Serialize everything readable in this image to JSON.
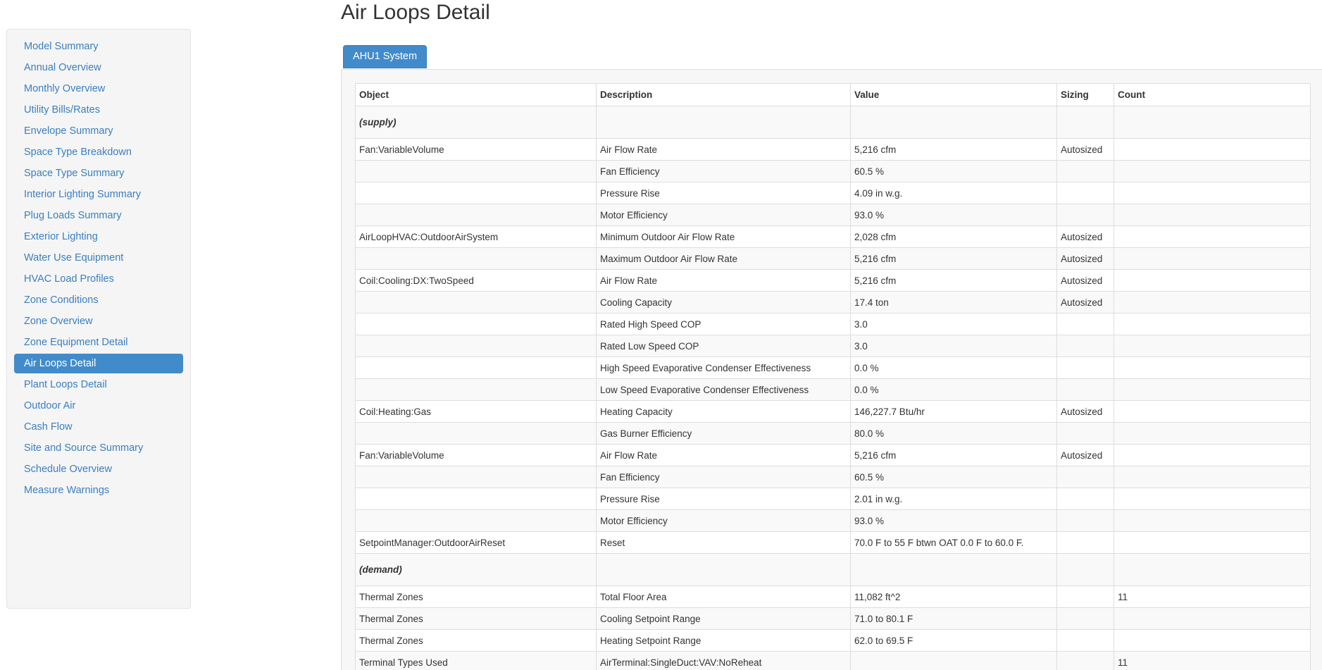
{
  "page": {
    "title": "Air Loops Detail"
  },
  "sidebar": {
    "items": [
      {
        "label": "Model Summary",
        "active": false
      },
      {
        "label": "Annual Overview",
        "active": false
      },
      {
        "label": "Monthly Overview",
        "active": false
      },
      {
        "label": "Utility Bills/Rates",
        "active": false
      },
      {
        "label": "Envelope Summary",
        "active": false
      },
      {
        "label": "Space Type Breakdown",
        "active": false
      },
      {
        "label": "Space Type Summary",
        "active": false
      },
      {
        "label": "Interior Lighting Summary",
        "active": false
      },
      {
        "label": "Plug Loads Summary",
        "active": false
      },
      {
        "label": "Exterior Lighting",
        "active": false
      },
      {
        "label": "Water Use Equipment",
        "active": false
      },
      {
        "label": "HVAC Load Profiles",
        "active": false
      },
      {
        "label": "Zone Conditions",
        "active": false
      },
      {
        "label": "Zone Overview",
        "active": false
      },
      {
        "label": "Zone Equipment Detail",
        "active": false
      },
      {
        "label": "Air Loops Detail",
        "active": true
      },
      {
        "label": "Plant Loops Detail",
        "active": false
      },
      {
        "label": "Outdoor Air",
        "active": false
      },
      {
        "label": "Cash Flow",
        "active": false
      },
      {
        "label": "Site and Source Summary",
        "active": false
      },
      {
        "label": "Schedule Overview",
        "active": false
      },
      {
        "label": "Measure Warnings",
        "active": false
      }
    ]
  },
  "tabs": [
    {
      "label": "AHU1 System",
      "active": true
    }
  ],
  "table": {
    "headers": [
      "Object",
      "Description",
      "Value",
      "Sizing",
      "Count"
    ],
    "rows": [
      {
        "section": true,
        "object": "(supply)",
        "description": "",
        "value": "",
        "sizing": "",
        "count": ""
      },
      {
        "object": "Fan:VariableVolume",
        "description": "Air Flow Rate",
        "value": "5,216 cfm",
        "sizing": "Autosized",
        "count": ""
      },
      {
        "object": "",
        "description": "Fan Efficiency",
        "value": "60.5 %",
        "sizing": "",
        "count": ""
      },
      {
        "object": "",
        "description": "Pressure Rise",
        "value": "4.09 in w.g.",
        "sizing": "",
        "count": ""
      },
      {
        "object": "",
        "description": "Motor Efficiency",
        "value": "93.0 %",
        "sizing": "",
        "count": ""
      },
      {
        "object": "AirLoopHVAC:OutdoorAirSystem",
        "description": "Minimum Outdoor Air Flow Rate",
        "value": "2,028 cfm",
        "sizing": "Autosized",
        "count": ""
      },
      {
        "object": "",
        "description": "Maximum Outdoor Air Flow Rate",
        "value": "5,216 cfm",
        "sizing": "Autosized",
        "count": ""
      },
      {
        "object": "Coil:Cooling:DX:TwoSpeed",
        "description": "Air Flow Rate",
        "value": "5,216 cfm",
        "sizing": "Autosized",
        "count": ""
      },
      {
        "object": "",
        "description": "Cooling Capacity",
        "value": "17.4 ton",
        "sizing": "Autosized",
        "count": ""
      },
      {
        "object": "",
        "description": "Rated High Speed COP",
        "value": "3.0",
        "sizing": "",
        "count": ""
      },
      {
        "object": "",
        "description": "Rated Low Speed COP",
        "value": "3.0",
        "sizing": "",
        "count": ""
      },
      {
        "object": "",
        "description": "High Speed Evaporative Condenser Effectiveness",
        "value": "0.0 %",
        "sizing": "",
        "count": ""
      },
      {
        "object": "",
        "description": "Low Speed Evaporative Condenser Effectiveness",
        "value": "0.0 %",
        "sizing": "",
        "count": ""
      },
      {
        "object": "Coil:Heating:Gas",
        "description": "Heating Capacity",
        "value": "146,227.7 Btu/hr",
        "sizing": "Autosized",
        "count": ""
      },
      {
        "object": "",
        "description": "Gas Burner Efficiency",
        "value": "80.0 %",
        "sizing": "",
        "count": ""
      },
      {
        "object": "Fan:VariableVolume",
        "description": "Air Flow Rate",
        "value": "5,216 cfm",
        "sizing": "Autosized",
        "count": ""
      },
      {
        "object": "",
        "description": "Fan Efficiency",
        "value": "60.5 %",
        "sizing": "",
        "count": ""
      },
      {
        "object": "",
        "description": "Pressure Rise",
        "value": "2.01 in w.g.",
        "sizing": "",
        "count": ""
      },
      {
        "object": "",
        "description": "Motor Efficiency",
        "value": "93.0 %",
        "sizing": "",
        "count": ""
      },
      {
        "object": "SetpointManager:OutdoorAirReset",
        "description": "Reset",
        "value": "70.0 F to 55 F btwn OAT 0.0 F to 60.0 F.",
        "sizing": "",
        "count": ""
      },
      {
        "section": true,
        "object": "(demand)",
        "description": "",
        "value": "",
        "sizing": "",
        "count": ""
      },
      {
        "object": "Thermal Zones",
        "description": "Total Floor Area",
        "value": "11,082 ft^2",
        "sizing": "",
        "count": "11"
      },
      {
        "object": "Thermal Zones",
        "description": "Cooling Setpoint Range",
        "value": "71.0 to 80.1 F",
        "sizing": "",
        "count": ""
      },
      {
        "object": "Thermal Zones",
        "description": "Heating Setpoint Range",
        "value": "62.0 to 69.5 F",
        "sizing": "",
        "count": ""
      },
      {
        "object": "Terminal Types Used",
        "description": "AirTerminal:SingleDuct:VAV:NoReheat",
        "value": "",
        "sizing": "",
        "count": "11"
      }
    ]
  },
  "colors": {
    "accent": "#428bca",
    "link": "#3a7fc1",
    "sidebar_bg": "#f5f5f5",
    "panel_bg": "#f7f7f7",
    "border": "#dddddd"
  }
}
